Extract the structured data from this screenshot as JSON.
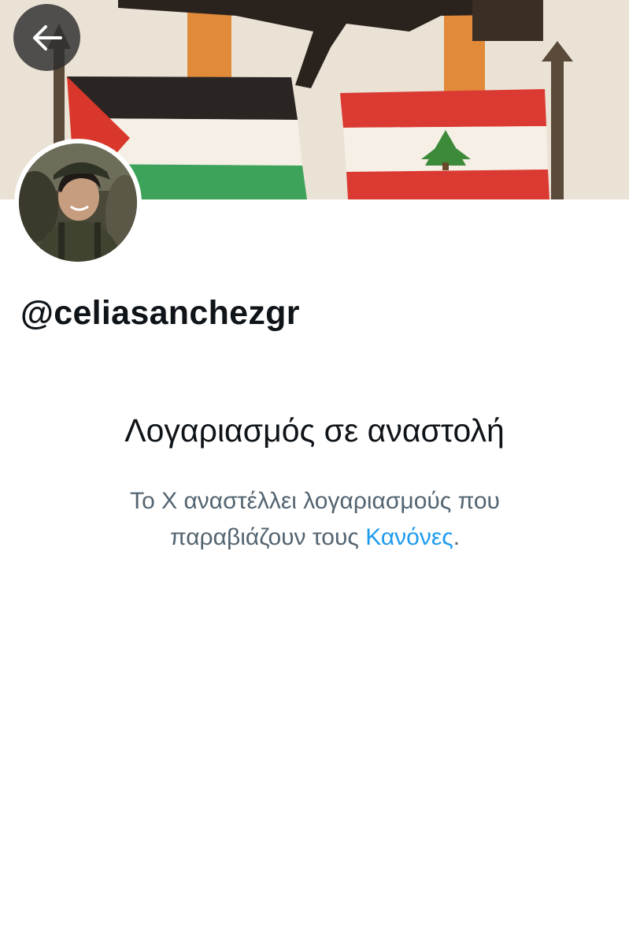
{
  "profile": {
    "handle": "@celiasanchezgr"
  },
  "navigation": {
    "back_icon": "arrow-left-icon"
  },
  "suspension": {
    "title": "Λογαριασμός σε αναστολή",
    "message_line1": "Το X αναστέλλει λογαριασμούς που",
    "message_line2_prefix": "παραβιάζουν τους ",
    "rules_link": "Κανόνες",
    "message_suffix": "."
  },
  "colors": {
    "link": "#1d9bf0",
    "secondary_text": "#536471",
    "primary_text": "#0f1419"
  }
}
